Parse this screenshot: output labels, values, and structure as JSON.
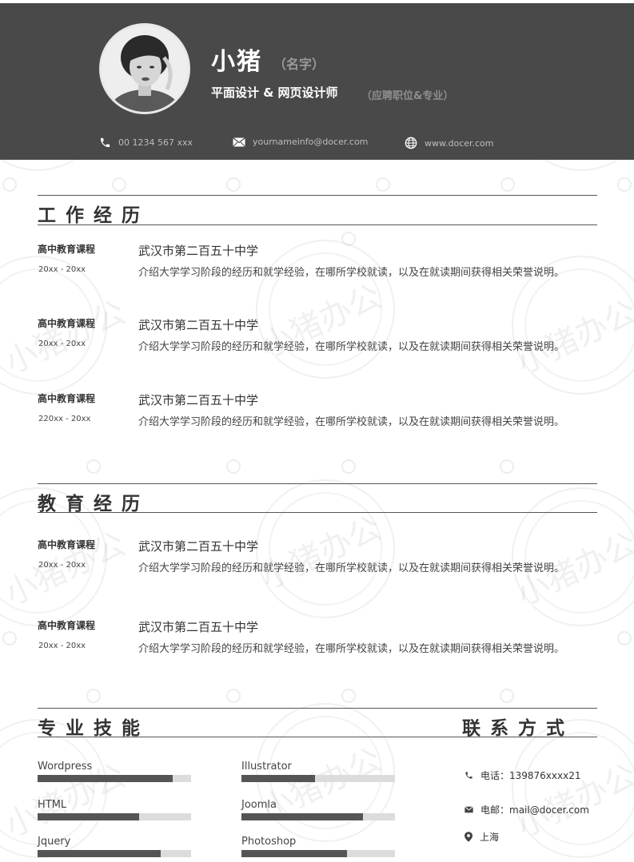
{
  "header": {
    "name": "小猪",
    "name_hint": "（名字）",
    "job_title": "平面设计 & 网页设计师",
    "job_hint": "（应聘职位&专业）",
    "phone": "00 1234 567 xxx",
    "email": "yournameinfo@docer.com",
    "website": "www.docer.com"
  },
  "work": {
    "title": "工作经历",
    "entries": [
      {
        "course": "高中教育课程",
        "period": "20xx - 20xx",
        "school": "武汉市第二百五十中学",
        "desc": "介绍大学学习阶段的经历和就学经验，在哪所学校就读，以及在就读期间获得相关荣誉说明。"
      },
      {
        "course": "高中教育课程",
        "period": "20xx - 20xx",
        "school": "武汉市第二百五十中学",
        "desc": "介绍大学学习阶段的经历和就学经验，在哪所学校就读，以及在就读期间获得相关荣誉说明。"
      },
      {
        "course": "高中教育课程",
        "period": "220xx - 20xx",
        "school": "武汉市第二百五十中学",
        "desc": "介绍大学学习阶段的经历和就学经验，在哪所学校就读，以及在就读期间获得相关荣誉说明。"
      }
    ]
  },
  "education": {
    "title": "教育经历",
    "entries": [
      {
        "course": "高中教育课程",
        "period": "20xx - 20xx",
        "school": "武汉市第二百五十中学",
        "desc": "介绍大学学习阶段的经历和就学经验，在哪所学校就读，以及在就读期间获得相关荣誉说明。"
      },
      {
        "course": "高中教育课程",
        "period": "20xx - 20xx",
        "school": "武汉市第二百五十中学",
        "desc": "介绍大学学习阶段的经历和就学经验，在哪所学校就读，以及在就读期间获得相关荣誉说明。"
      }
    ]
  },
  "skills": {
    "title": "专业技能",
    "items": [
      {
        "name": "Wordpress",
        "level": 0.88
      },
      {
        "name": "Illustrator",
        "level": 0.48
      },
      {
        "name": "HTML",
        "level": 0.66
      },
      {
        "name": "Joomla",
        "level": 0.79
      },
      {
        "name": "Jquery",
        "level": 0.8
      },
      {
        "name": "Photoshop",
        "level": 0.69
      }
    ]
  },
  "contact": {
    "title": "联系方式",
    "phone": "电话：139876xxxx21",
    "email": "电邮：mail@docer.com",
    "location": "上海"
  },
  "watermark": "小猪办公",
  "colors": {
    "header_bg": "#49494a",
    "bar_fill": "#555555",
    "bar_track": "#dcdcdc"
  },
  "icons": [
    "phone-icon",
    "mail-icon",
    "globe-icon",
    "location-icon"
  ]
}
